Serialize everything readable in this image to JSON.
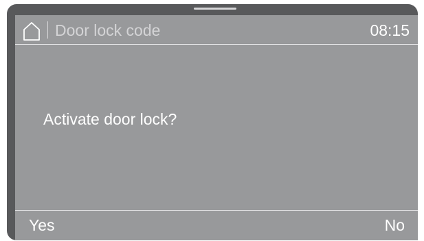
{
  "header": {
    "home_icon": "home-icon",
    "title": "Door lock code",
    "time": "08:15"
  },
  "dialog": {
    "prompt": "Activate door lock?"
  },
  "footer": {
    "yes_label": "Yes",
    "no_label": "No"
  },
  "colors": {
    "frame": "#58595b",
    "screen": "#98999b",
    "text": "#ffffff",
    "title_text": "#d4d4d6",
    "divider": "#e4e4e6"
  }
}
